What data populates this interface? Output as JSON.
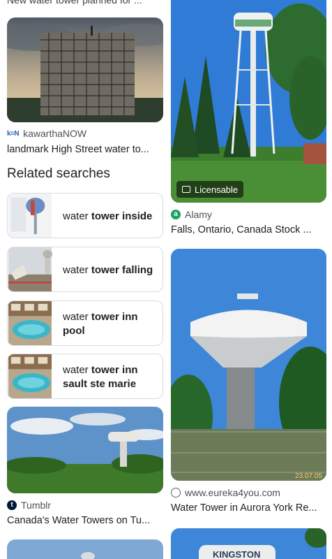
{
  "top_cutoff_text": "New water tower planned for ...",
  "results_left": [
    {
      "source": "kawarthaNOW",
      "source_icon": "kawarthanow-logo-icon",
      "caption": "landmark High Street water to..."
    },
    {
      "source": "Tumblr",
      "source_icon": "tumblr-icon",
      "caption": "Canada's Water Towers on Tu..."
    }
  ],
  "results_right": [
    {
      "badge": "Licensable",
      "badge_icon": "image-icon",
      "source": "Alamy",
      "source_icon": "alamy-icon",
      "caption": "Falls, Ontario, Canada Stock ..."
    },
    {
      "source": "www.eureka4you.com",
      "source_icon": "globe-icon",
      "caption": "Water Tower in Aurora York Re...",
      "image_stamp": "23.07.05"
    },
    {
      "image_sign": "KINGSTON"
    }
  ],
  "related_searches": {
    "title": "Related searches",
    "items": [
      {
        "plain": "water ",
        "bold": "tower inside"
      },
      {
        "plain": "water ",
        "bold": "tower falling"
      },
      {
        "plain": "water ",
        "bold": "tower inn pool"
      },
      {
        "plain": "water ",
        "bold": "tower inn sault ste marie"
      }
    ]
  },
  "colors": {
    "card_border": "#dadce0",
    "text": "#202124",
    "alamy_green": "#1aa260"
  }
}
